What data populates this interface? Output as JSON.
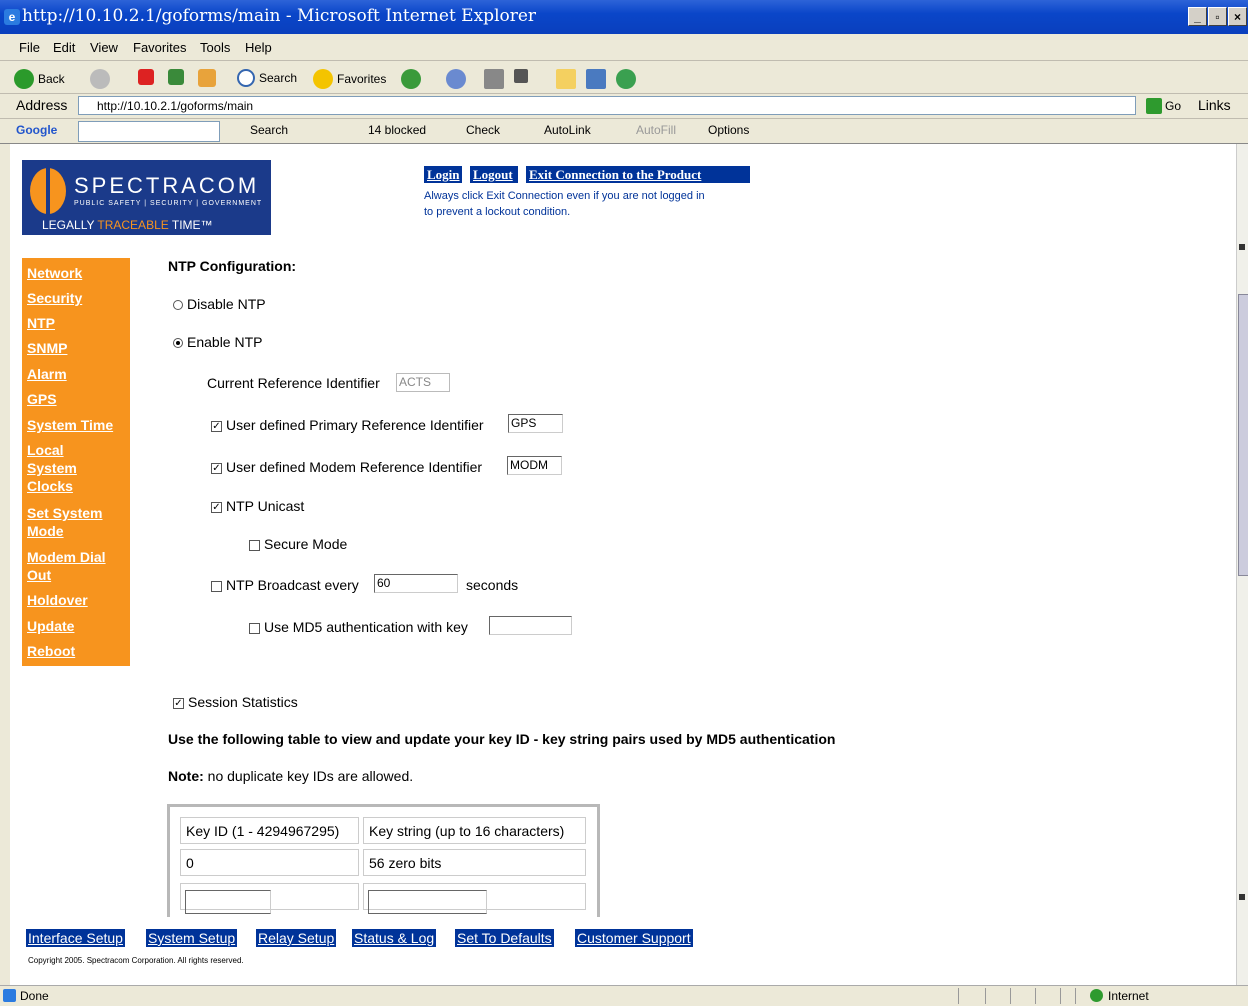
{
  "window": {
    "title": "http://10.10.2.1/goforms/main - Microsoft Internet Explorer",
    "min": "_",
    "max": "▫",
    "close": "×"
  },
  "menu": [
    "File",
    "Edit",
    "View",
    "Favorites",
    "Tools",
    "Help"
  ],
  "toolbar": {
    "back": "Back",
    "search": "Search",
    "favorites": "Favorites"
  },
  "address": {
    "label": "Address",
    "url": "http://10.10.2.1/goforms/main",
    "go": "Go",
    "links": "Links"
  },
  "googlebar": {
    "logo": "Google",
    "search": "Search",
    "blocked": "14 blocked",
    "check": "Check",
    "autolink": "AutoLink",
    "autofill": "AutoFill",
    "options": "Options"
  },
  "logo": {
    "brand": "SPECTRACOM",
    "tagline": "PUBLIC SAFETY | SECURITY | GOVERNMENT",
    "slogan_a": "LEGALLY ",
    "slogan_b": "TRACEABLE",
    "slogan_c": " TIME™"
  },
  "toplinks": {
    "login": "Login",
    "logout": "Logout",
    "exit": "Exit Connection to the Product"
  },
  "exit_note": {
    "line1": "Always click Exit Connection even if you are not logged in",
    "line2": "to prevent a lockout condition."
  },
  "sidenav": [
    "Network",
    "Security",
    "NTP",
    "SNMP",
    "Alarm",
    "GPS",
    "System Time",
    "Local System Clocks",
    "Set System Mode",
    "Modem Dial Out",
    "Holdover",
    "Update",
    "Reboot"
  ],
  "form": {
    "heading": "NTP Configuration:",
    "disable_ntp": "Disable NTP",
    "enable_ntp": "Enable NTP",
    "current_ref_label": "Current Reference Identifier",
    "current_ref_value": "ACTS",
    "primary_ref_label": "User defined Primary Reference Identifier",
    "primary_ref_value": "GPS",
    "modem_ref_label": "User defined Modem Reference Identifier",
    "modem_ref_value": "MODM",
    "unicast_label": "NTP Unicast",
    "secure_label": "Secure Mode",
    "broadcast_label": "NTP Broadcast every",
    "broadcast_value": "60",
    "seconds_label": "seconds",
    "md5_label": "Use MD5 authentication with key",
    "session_label": "Session Statistics",
    "table_heading": "Use the following table to view and update your key ID - key string pairs used by MD5 authentication",
    "note_bold": "Note:",
    "note_text": " no duplicate key IDs are allowed."
  },
  "keytable": {
    "headers": [
      "Key ID (1 - 4294967295)",
      "Key string (up to 16 characters)"
    ],
    "rows": [
      [
        "0",
        "56 zero bits"
      ]
    ]
  },
  "bottomnav": [
    "Interface Setup",
    "System Setup",
    "Relay Setup",
    "Status & Log",
    "Set To Defaults",
    "Customer Support"
  ],
  "copyright": "Copyright 2005. Spectracom Corporation. All rights reserved.",
  "status": {
    "text": "Done",
    "zone": "Internet"
  }
}
